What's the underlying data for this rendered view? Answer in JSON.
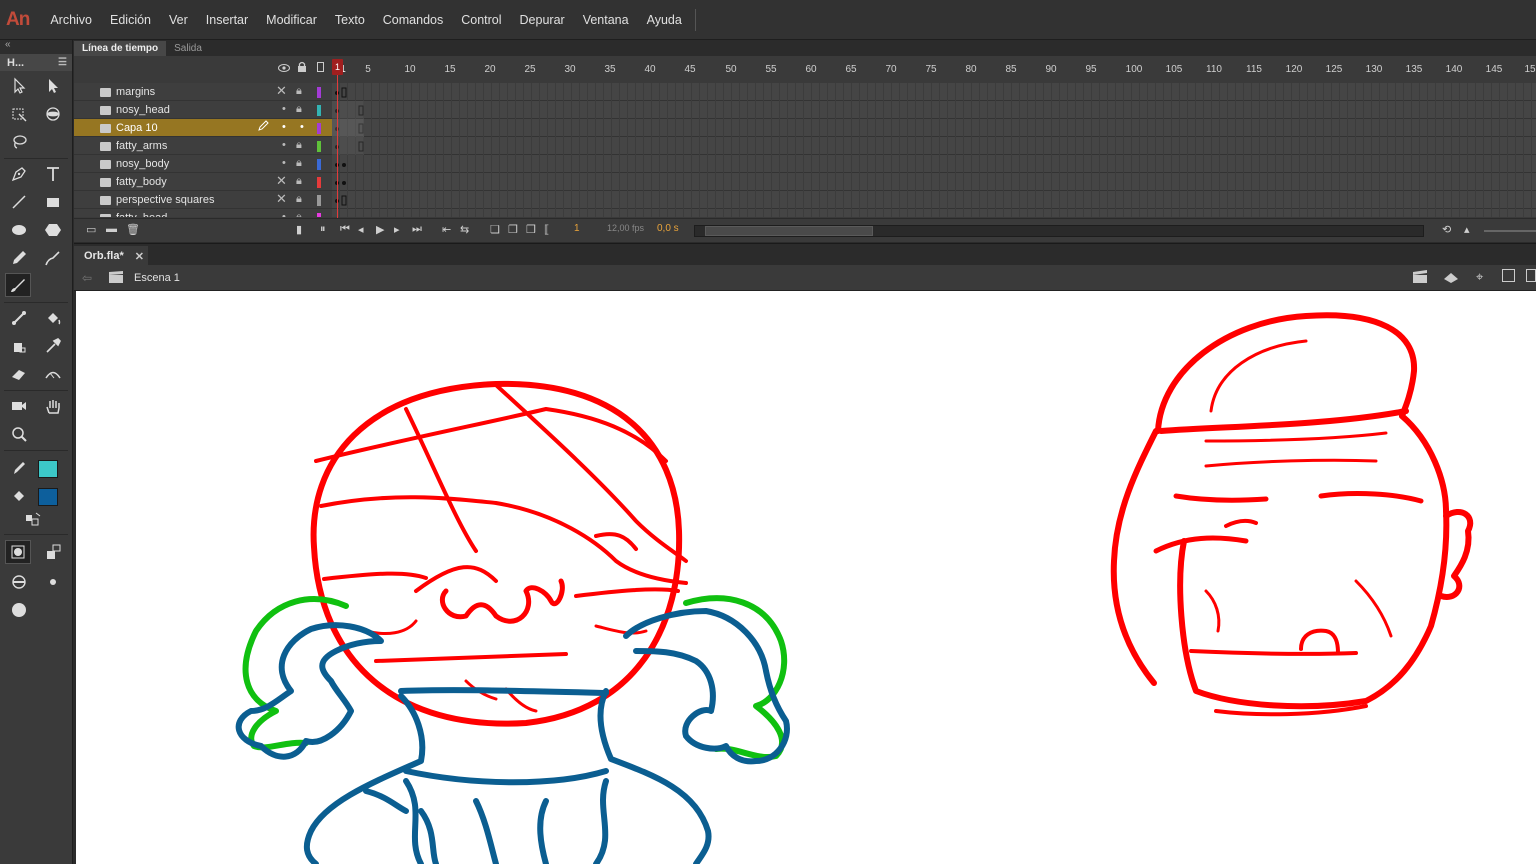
{
  "app": {
    "logo": "An"
  },
  "menu": [
    "Archivo",
    "Edición",
    "Ver",
    "Insertar",
    "Modificar",
    "Texto",
    "Comandos",
    "Control",
    "Depurar",
    "Ventana",
    "Ayuda"
  ],
  "toolbox": {
    "title": "H...",
    "stroke_color": "#3cc8c8",
    "fill_color": "#0d5f9c"
  },
  "timeline": {
    "tabs": [
      "Línea de tiempo",
      "Salida"
    ],
    "ruler": [
      "1",
      "5",
      "10",
      "15",
      "20",
      "25",
      "30",
      "35",
      "40",
      "45",
      "50",
      "55",
      "60",
      "65",
      "70",
      "75",
      "80",
      "85",
      "90",
      "95",
      "100",
      "105",
      "110",
      "115",
      "120",
      "125",
      "130",
      "135",
      "140",
      "145",
      "15"
    ],
    "layers": [
      {
        "name": "margins",
        "color": "#a43bd6"
      },
      {
        "name": "nosy_head",
        "color": "#33b3b3"
      },
      {
        "name": "Capa 10",
        "color": "#a43bd6"
      },
      {
        "name": "fatty_arms",
        "color": "#5fc13a"
      },
      {
        "name": "nosy_body",
        "color": "#3a6ad6"
      },
      {
        "name": "fatty_body",
        "color": "#e63b3b"
      },
      {
        "name": "perspective squares",
        "color": "#999999"
      },
      {
        "name": "fatty_head",
        "color": "#e63be0"
      }
    ],
    "current_frame": "1",
    "fps": "12,00 fps",
    "time": "0,0 s"
  },
  "document": {
    "tab": "Orb.fla*",
    "scene": "Escena 1"
  },
  "colors": {
    "red": "#ff0000",
    "blue": "#0b5e91",
    "green": "#10c010"
  }
}
